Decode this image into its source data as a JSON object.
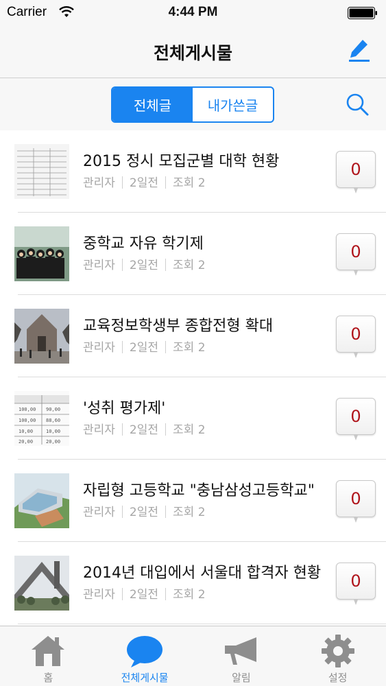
{
  "status_bar": {
    "carrier": "Carrier",
    "time": "4:44 PM"
  },
  "nav": {
    "title": "전체게시물",
    "compose_icon": "pencil-icon"
  },
  "segments": [
    {
      "label": "전체글",
      "selected": true
    },
    {
      "label": "내가쓴글",
      "selected": false
    }
  ],
  "search_icon": "search-icon",
  "posts": [
    {
      "title": "2015 정시 모집군별 대학 현황",
      "author": "관리자",
      "date": "2일전",
      "views": "조회 2",
      "comments": "0"
    },
    {
      "title": "중학교 자유 학기제",
      "author": "관리자",
      "date": "2일전",
      "views": "조회 2",
      "comments": "0"
    },
    {
      "title": "교육정보학생부 종합전형 확대",
      "author": "관리자",
      "date": "2일전",
      "views": "조회 2",
      "comments": "0"
    },
    {
      "title": "'성취 평가제'",
      "author": "관리자",
      "date": "2일전",
      "views": "조회 2",
      "comments": "0"
    },
    {
      "title": "자립형 고등학교 \"충남삼성고등학교\"",
      "author": "관리자",
      "date": "2일전",
      "views": "조회 2",
      "comments": "0"
    },
    {
      "title": "2014년 대입에서 서울대 합격자 현황",
      "author": "관리자",
      "date": "2일전",
      "views": "조회 2",
      "comments": "0"
    }
  ],
  "tabs": [
    {
      "label": "홈",
      "icon": "home-icon",
      "active": false
    },
    {
      "label": "전체게시물",
      "icon": "speech-bubble-icon",
      "active": true
    },
    {
      "label": "알림",
      "icon": "megaphone-icon",
      "active": false
    },
    {
      "label": "설정",
      "icon": "gear-icon",
      "active": false
    }
  ],
  "colors": {
    "accent": "#1a84f0",
    "badge_text": "#b0141b",
    "meta_text": "#a6a6a6"
  }
}
